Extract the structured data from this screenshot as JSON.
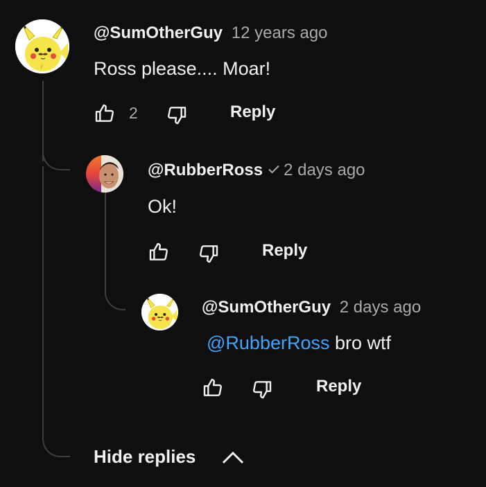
{
  "comment": {
    "handle": "@SumOtherGuy",
    "time": "12 years ago",
    "text": "Ross please.... Moar!",
    "likes": "2",
    "reply_label": "Reply"
  },
  "reply1": {
    "handle": "@RubberRoss",
    "verified": true,
    "time": "2 days ago",
    "text": "Ok!",
    "reply_label": "Reply"
  },
  "reply2": {
    "handle": "@SumOtherGuy",
    "time": "2 days ago",
    "mention": "@RubberRoss",
    "text": " bro wtf",
    "reply_label": "Reply"
  },
  "hide_replies_label": "Hide replies",
  "colors": {
    "background": "#0f0f0f",
    "text": "#f1f1f1",
    "secondary": "#aaaaaa",
    "link": "#3ea6ff",
    "thread_line": "#3f3f3f"
  },
  "icons": [
    "pikachu-avatar",
    "rubberross-avatar",
    "thumb-up-icon",
    "thumb-down-icon",
    "verified-check-icon",
    "chevron-up-icon"
  ]
}
